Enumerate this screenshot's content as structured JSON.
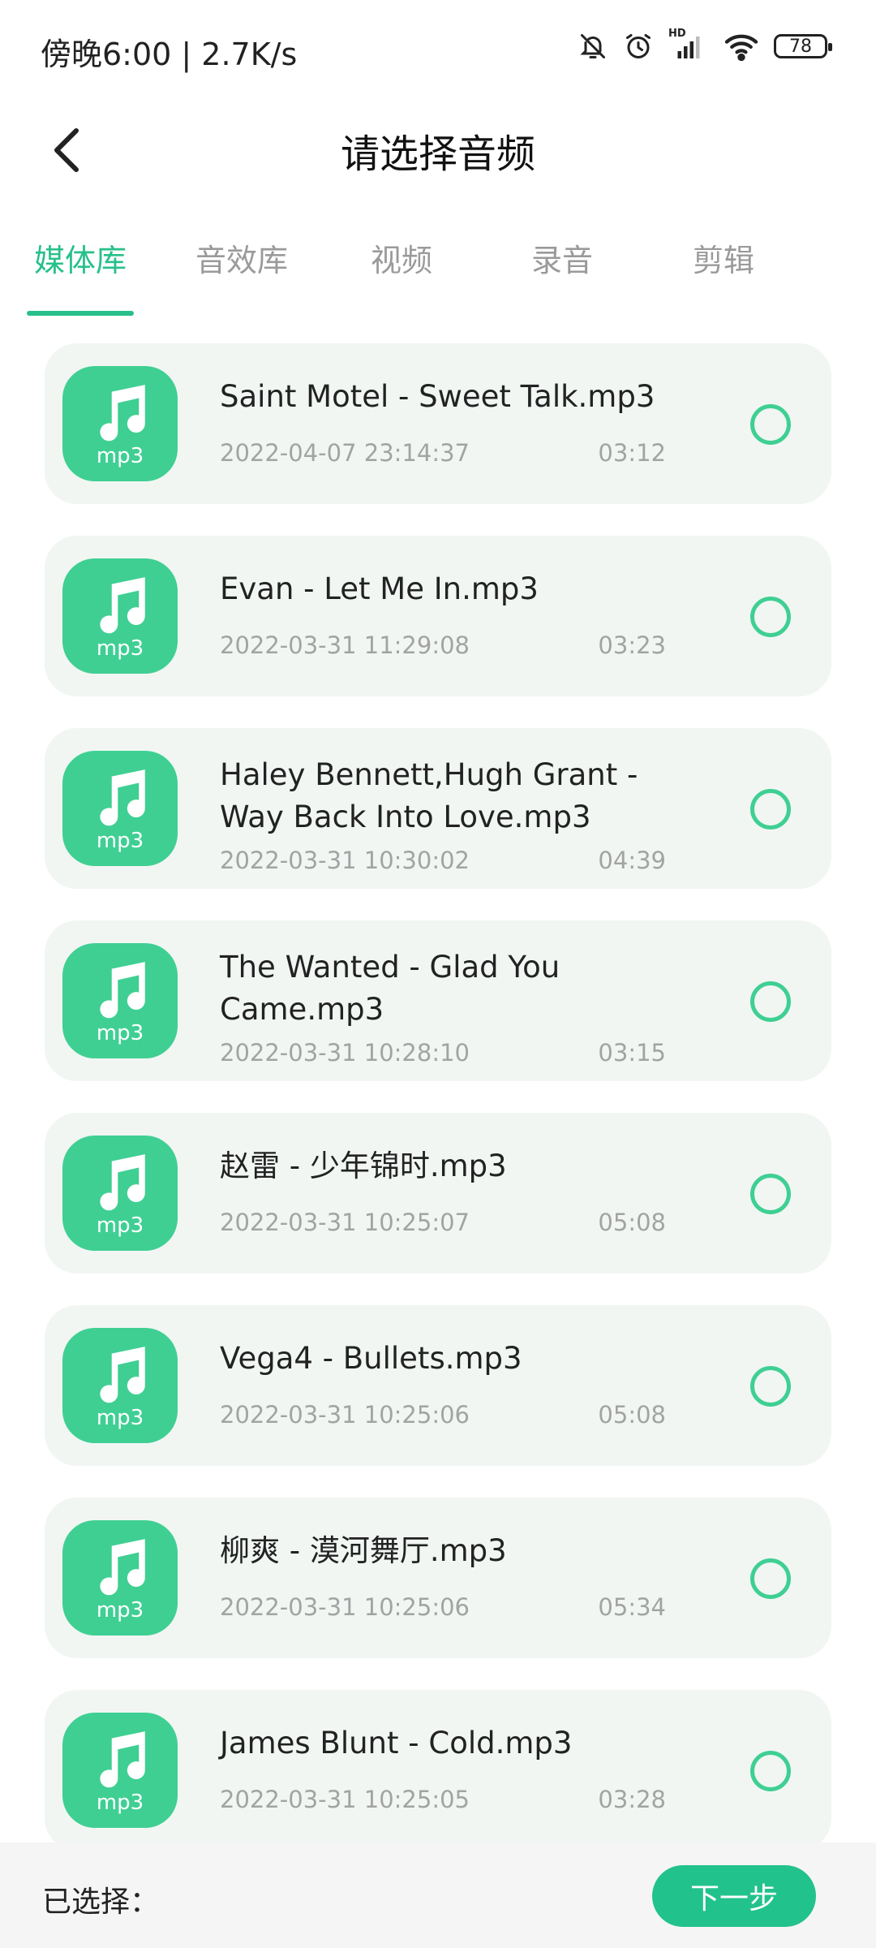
{
  "status_bar": {
    "time_speed": "傍晚6:00 | 2.7K/s",
    "hd": "HD",
    "battery": "78"
  },
  "header": {
    "title": "请选择音频"
  },
  "tabs": [
    {
      "label": "媒体库"
    },
    {
      "label": "音效库"
    },
    {
      "label": "视频"
    },
    {
      "label": "录音"
    },
    {
      "label": "剪辑"
    }
  ],
  "accent_color": "#27c08a",
  "items": [
    {
      "format": "mp3",
      "title": "Saint Motel - Sweet Talk.mp3",
      "date": "2022-04-07 23:14:37",
      "duration": "03:12"
    },
    {
      "format": "mp3",
      "title": "Evan - Let Me In.mp3",
      "date": "2022-03-31 11:29:08",
      "duration": "03:23"
    },
    {
      "format": "mp3",
      "title": "Haley Bennett,Hugh Grant - Way Back Into Love.mp3",
      "date": "2022-03-31 10:30:02",
      "duration": "04:39"
    },
    {
      "format": "mp3",
      "title": "The Wanted - Glad You Came.mp3",
      "date": "2022-03-31 10:28:10",
      "duration": "03:15"
    },
    {
      "format": "mp3",
      "title": "赵雷 - 少年锦时.mp3",
      "date": "2022-03-31 10:25:07",
      "duration": "05:08"
    },
    {
      "format": "mp3",
      "title": "Vega4 - Bullets.mp3",
      "date": "2022-03-31 10:25:06",
      "duration": "05:08"
    },
    {
      "format": "mp3",
      "title": "柳爽 - 漠河舞厅.mp3",
      "date": "2022-03-31 10:25:06",
      "duration": "05:34"
    },
    {
      "format": "mp3",
      "title": "James Blunt - Cold.mp3",
      "date": "2022-03-31 10:25:05",
      "duration": "03:28"
    }
  ],
  "bottom": {
    "selected_label": "已选择：",
    "next_label": "下一步"
  }
}
